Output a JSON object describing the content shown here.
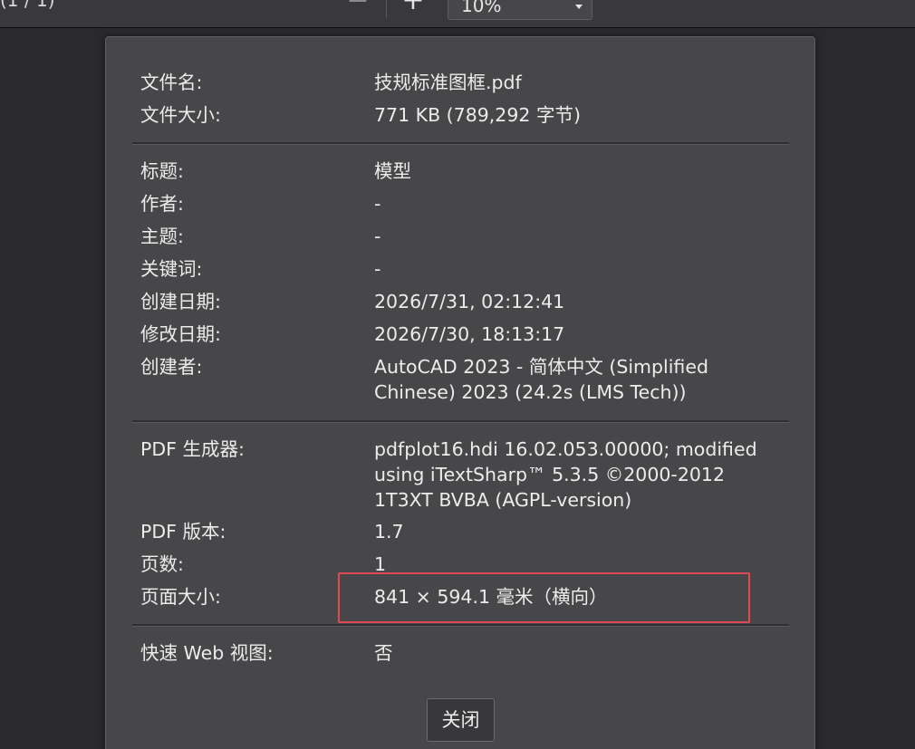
{
  "toolbar": {
    "page_count": "(1 / 1)",
    "zoom_out_label": "−",
    "zoom_in_label": "+",
    "zoom_value": "10%"
  },
  "dialog": {
    "file_name_label": "文件名:",
    "file_name_value": "技规标准图框.pdf",
    "file_size_label": "文件大小:",
    "file_size_value": "771 KB (789,292 字节)",
    "title_label": "标题:",
    "title_value": "模型",
    "author_label": "作者:",
    "author_value": "-",
    "subject_label": "主题:",
    "subject_value": "-",
    "keywords_label": "关键词:",
    "keywords_value": "-",
    "created_label": "创建日期:",
    "created_value": "2026/7/31, 02:12:41",
    "modified_label": "修改日期:",
    "modified_value": "2026/7/30, 18:13:17",
    "creator_label": "创建者:",
    "creator_value": "AutoCAD 2023 - 简体中文 (Simplified Chinese) 2023 (24.2s (LMS Tech))",
    "producer_label": "PDF 生成器:",
    "producer_value": "pdfplot16.hdi 16.02.053.00000; modified using iTextSharp™ 5.3.5 ©2000-2012 1T3XT BVBA (AGPL-version)",
    "version_label": "PDF 版本:",
    "version_value": "1.7",
    "page_count_label": "页数:",
    "page_count_value": "1",
    "page_size_label": "页面大小:",
    "page_size_value": "841 × 594.1 毫米（横向）",
    "fast_web_label": "快速 Web 视图:",
    "fast_web_value": "否",
    "close_label": "关闭"
  },
  "colors": {
    "background": "#2a2a2e",
    "dialog_background": "#474749",
    "text": "#ececec",
    "highlight_border": "#e04a57"
  }
}
